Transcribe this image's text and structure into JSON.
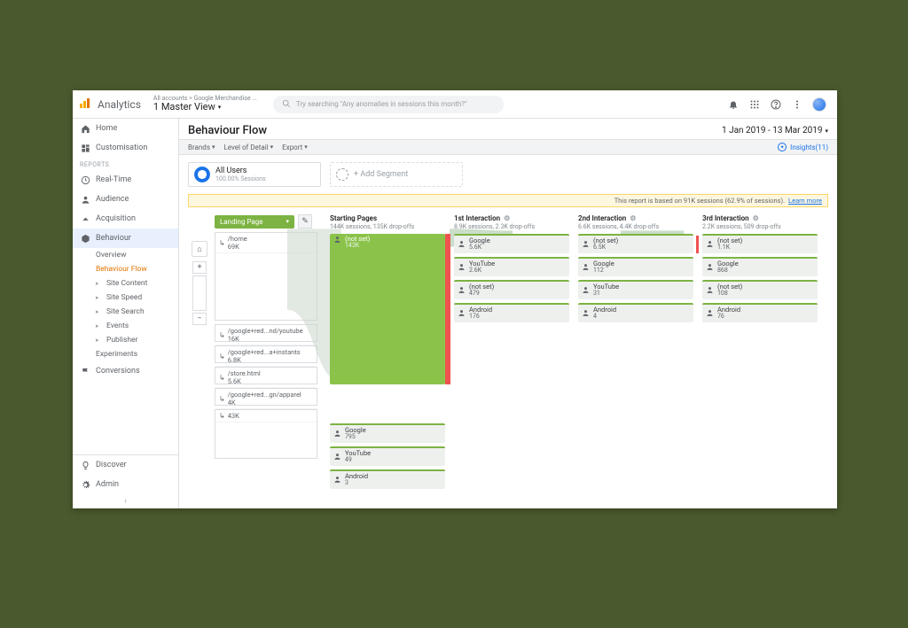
{
  "header": {
    "brand": "Analytics",
    "breadcrumb": "All accounts > Google Merchandise ...",
    "view": "1 Master View",
    "search_placeholder": "Try searching \"Any anomalies in sessions this month?\""
  },
  "sidebar": {
    "top": [
      {
        "icon": "home",
        "label": "Home"
      },
      {
        "icon": "grid",
        "label": "Customisation"
      }
    ],
    "reports_header": "REPORTS",
    "reports": [
      {
        "icon": "clock",
        "label": "Real-Time"
      },
      {
        "icon": "user",
        "label": "Audience"
      },
      {
        "icon": "arrow",
        "label": "Acquisition"
      },
      {
        "icon": "cube",
        "label": "Behaviour",
        "active": true
      }
    ],
    "behaviour_sub": [
      {
        "label": "Overview"
      },
      {
        "label": "Behaviour Flow",
        "selected": true
      },
      {
        "label": "Site Content",
        "expandable": true
      },
      {
        "label": "Site Speed",
        "expandable": true
      },
      {
        "label": "Site Search",
        "expandable": true
      },
      {
        "label": "Events",
        "expandable": true
      },
      {
        "label": "Publisher",
        "expandable": true
      },
      {
        "label": "Experiments"
      }
    ],
    "conversions": {
      "icon": "flag",
      "label": "Conversions"
    },
    "bottom": [
      {
        "icon": "bulb",
        "label": "Discover"
      },
      {
        "icon": "gear",
        "label": "Admin"
      }
    ]
  },
  "page": {
    "title": "Behaviour Flow",
    "date_range": "1 Jan 2019 - 13 Mar 2019",
    "toolbar": {
      "brands": "Brands",
      "level": "Level of Detail",
      "export": "Export",
      "insights_label": "Insights",
      "insights_count": "(11)"
    },
    "segments": {
      "all_users": {
        "title": "All Users",
        "sub": "100.00% Sessions"
      },
      "add": "+ Add Segment"
    },
    "notice": {
      "text": "This report is based on 91K sessions (62.9% of sessions).",
      "link": "Learn more"
    }
  },
  "flow": {
    "dimension": "Landing Page",
    "zoom_home": "⌂",
    "columns": [
      {
        "key": "landing",
        "title": "",
        "pages": [
          {
            "label": "/home",
            "value": "69K",
            "big": true
          },
          {
            "label": "/google+red...nd/youtube",
            "value": "16K"
          },
          {
            "label": "/google+red...a+instants",
            "value": "6.8K"
          },
          {
            "label": "/store.html",
            "value": "5.6K"
          },
          {
            "label": "/google+red...gn/apparel",
            "value": "4K"
          },
          {
            "label": "",
            "value": "43K",
            "big2": true
          }
        ]
      },
      {
        "key": "start",
        "title": "Starting Pages",
        "sub": "144K sessions, 135K drop-offs",
        "nodes": [
          {
            "label": "(not set)",
            "value": "143K",
            "big": true,
            "dropoff": true
          }
        ],
        "extra_nodes": [
          {
            "label": "Google",
            "value": "795"
          },
          {
            "label": "YouTube",
            "value": "49"
          },
          {
            "label": "Android",
            "value": "3"
          }
        ]
      },
      {
        "key": "int1",
        "title": "1st Interaction",
        "sub": "8.9K sessions, 2.3K drop-offs",
        "gear": true,
        "nodes": [
          {
            "label": "Google",
            "value": "5.6K"
          },
          {
            "label": "YouTube",
            "value": "2.6K"
          },
          {
            "label": "(not set)",
            "value": "479"
          },
          {
            "label": "Android",
            "value": "176"
          }
        ]
      },
      {
        "key": "int2",
        "title": "2nd Interaction",
        "sub": "6.6K sessions, 4.4K drop-offs",
        "gear": true,
        "nodes": [
          {
            "label": "(not set)",
            "value": "6.5K"
          },
          {
            "label": "Google",
            "value": "112"
          },
          {
            "label": "YouTube",
            "value": "31"
          },
          {
            "label": "Android",
            "value": "4"
          }
        ]
      },
      {
        "key": "int3",
        "title": "3rd Interaction",
        "sub": "2.2K sessions, 509 drop-offs",
        "gear": true,
        "nodes": [
          {
            "label": "(not set)",
            "value": "1.1K"
          },
          {
            "label": "Google",
            "value": "868"
          },
          {
            "label": "(not set)",
            "value": "108"
          },
          {
            "label": "Android",
            "value": "76"
          }
        ]
      }
    ]
  }
}
